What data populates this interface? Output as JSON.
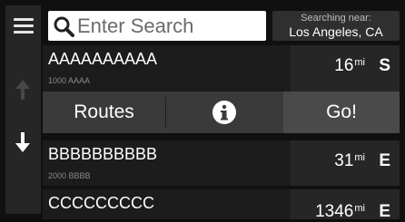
{
  "search": {
    "placeholder": "Enter Search",
    "near_label": "Searching near:",
    "near_value": "Los Angeles, CA"
  },
  "results": [
    {
      "name": "AAAAAAAAAA",
      "address": "1000 AAAA",
      "distance": "16",
      "unit": "mi",
      "direction": "S"
    },
    {
      "name": "BBBBBBBBBB",
      "address": "2000 BBBB",
      "distance": "31",
      "unit": "mi",
      "direction": "E"
    },
    {
      "name": "CCCCCCCCC",
      "address": "",
      "distance": "1346",
      "unit": "mi",
      "direction": "E"
    }
  ],
  "actions": {
    "routes_label": "Routes",
    "go_label": "Go!"
  },
  "icons": {
    "menu": "menu-icon",
    "scroll_up": "arrow-up-icon",
    "scroll_down": "arrow-down-icon",
    "search": "search-icon",
    "info": "info-icon"
  }
}
